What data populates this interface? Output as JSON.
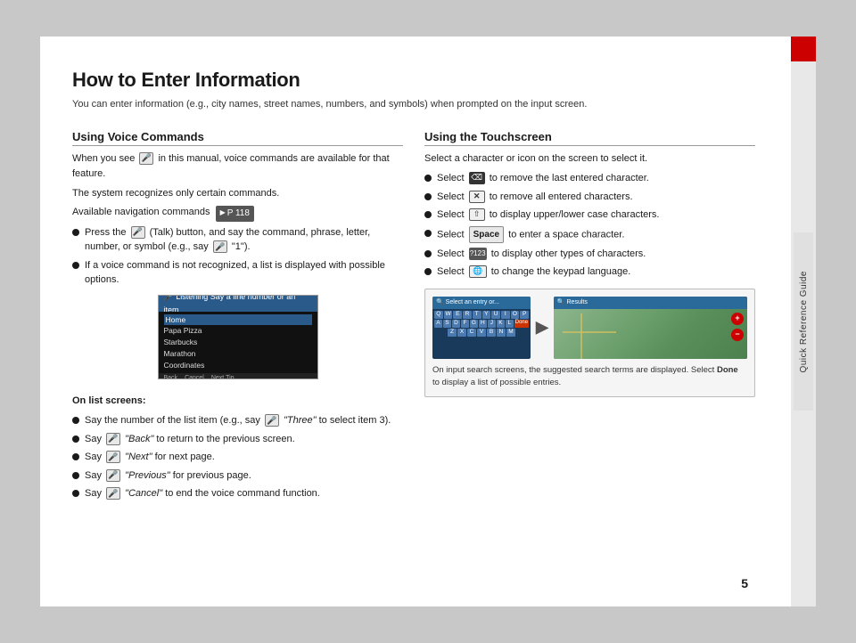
{
  "page": {
    "number": "5",
    "background": "#c8c8c8"
  },
  "sidebar": {
    "label": "Quick Reference Guide"
  },
  "header": {
    "title": "How to Enter Information",
    "subtitle": "You can enter information (e.g., city names, street names, numbers, and symbols) when prompted on the input screen."
  },
  "left_section": {
    "title": "Using Voice Commands",
    "intro1": "When you see",
    "intro2": "in this manual, voice commands are available for that feature.",
    "intro3": "The system recognizes only certain commands.",
    "intro4": "Available navigation commands",
    "page_ref": "P 118",
    "bullets": [
      {
        "text": "(Talk) button, and say the command, phrase, letter, number, or symbol (e.g., say",
        "suffix": "\"1\").",
        "prefix": "Press the"
      },
      {
        "text": "If a voice command is not recognized, a list is displayed with possible options."
      }
    ],
    "screenshot": {
      "header": "Listening  Say a line number or an item",
      "items": [
        "Home",
        "Papa Pizza",
        "Starbucks",
        "Marathon",
        "Coordinates"
      ],
      "footer_items": [
        "Back",
        "Cancel",
        "Next Tip"
      ]
    }
  },
  "on_list_section": {
    "title": "On list screens:",
    "bullets": [
      {
        "text": "Say the number of the list item (e.g., say",
        "italic_part": "\"Three\"",
        "suffix": "to select item 3)."
      },
      {
        "text": "Say",
        "italic_part": "\"Back\"",
        "suffix": "to return to the previous screen."
      },
      {
        "text": "Say",
        "italic_part": "\"Next\"",
        "suffix": "for next page."
      },
      {
        "text": "Say",
        "italic_part": "\"Previous\"",
        "suffix": "for previous page."
      },
      {
        "text": "Say",
        "italic_part": "\"Cancel\"",
        "suffix": "to end the voice command function."
      }
    ]
  },
  "right_section": {
    "title": "Using the Touchscreen",
    "intro": "Select a character or icon on the screen to select it.",
    "bullets": [
      {
        "icon": "backspace",
        "text": "to remove the last entered character."
      },
      {
        "icon": "x",
        "text": "to remove all entered characters."
      },
      {
        "icon": "up-arrow",
        "text": "to display upper/lower case characters."
      },
      {
        "icon": "space",
        "text": "to enter a space character."
      },
      {
        "icon": "7123",
        "text": "to display other types of characters."
      },
      {
        "icon": "globe",
        "text": "to change the keypad language."
      }
    ],
    "select_label": "Select",
    "image_caption": "On input search screens, the suggested search terms are displayed. Select",
    "done_label": "Done",
    "image_caption2": "to display a list of possible entries.",
    "keyboard_rows": [
      [
        "Q",
        "W",
        "E",
        "R",
        "T",
        "Y",
        "U",
        "I",
        "O",
        "P"
      ],
      [
        "A",
        "S",
        "D",
        "F",
        "G",
        "H",
        "J",
        "K",
        "L"
      ],
      [
        "Z",
        "X",
        "C",
        "V",
        "B",
        "N",
        "M"
      ]
    ]
  }
}
